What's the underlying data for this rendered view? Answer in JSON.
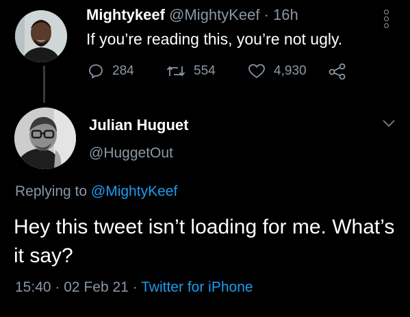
{
  "original_tweet": {
    "author_name": "Mightykeef",
    "author_handle": "@MightyKeef",
    "separator": "·",
    "time_ago": "16h",
    "text": "If you’re reading this, you’re not ugly.",
    "stats": {
      "replies": "284",
      "retweets": "554",
      "likes": "4,930"
    },
    "icons": [
      "reply-icon",
      "retweet-icon",
      "like-icon",
      "share-icon",
      "more-options-icon"
    ]
  },
  "reply_tweet": {
    "author_name": "Julian Huguet",
    "author_handle": "@HuggetOut",
    "replying_prefix": "Replying to",
    "replying_to": "@MightyKeef",
    "text": "Hey this tweet isn’t loading for me. What’s it say?",
    "time": "15:40",
    "date": "02 Feb 21",
    "source": "Twitter for iPhone",
    "separator": "·",
    "icons": [
      "chevron-down-icon"
    ]
  },
  "colors": {
    "background": "#000000",
    "primary_text": "#ffffff",
    "secondary_text": "#8b98a5",
    "link": "#1d9bf0",
    "thread_line": "#3a3a3a"
  }
}
